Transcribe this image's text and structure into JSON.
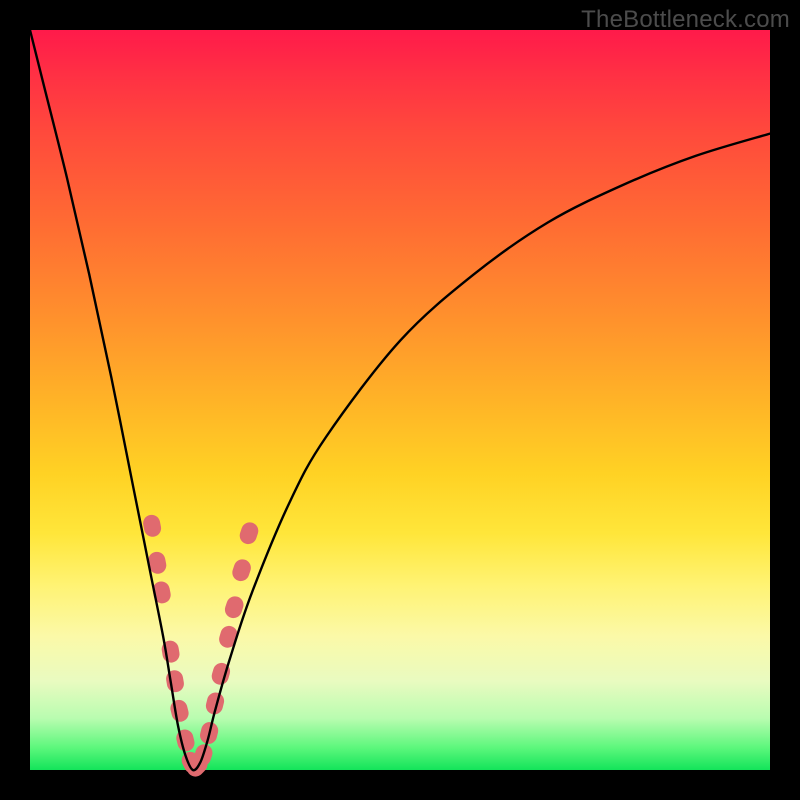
{
  "watermark": "TheBottleneck.com",
  "colors": {
    "frame": "#000000",
    "marker": "#e06a6f",
    "curve": "#000000"
  },
  "chart_data": {
    "type": "line",
    "title": "",
    "xlabel": "",
    "ylabel": "",
    "xlim": [
      0,
      100
    ],
    "ylim": [
      0,
      100
    ],
    "grid": false,
    "legend": false,
    "curve_description": "V-shaped bottleneck curve; minimum near x≈22 at y≈0, asymmetric — left arm is near-vertical, right arm rises gradually",
    "x": [
      0,
      2,
      5,
      8,
      11,
      14,
      16,
      18,
      19,
      20,
      21,
      22,
      23,
      24,
      25,
      27,
      30,
      35,
      40,
      50,
      60,
      70,
      80,
      90,
      100
    ],
    "y": [
      100,
      92,
      80,
      67,
      53,
      38,
      28,
      18,
      12,
      6,
      2,
      0,
      1,
      4,
      8,
      15,
      24,
      36,
      45,
      58,
      67,
      74,
      79,
      83,
      86
    ],
    "markers_description": "Salmon pill-shaped markers clustered along both arms near the trough (approx x 16–29, y 0–33)",
    "markers": [
      {
        "x": 16.5,
        "y": 33
      },
      {
        "x": 17.2,
        "y": 28
      },
      {
        "x": 17.8,
        "y": 24
      },
      {
        "x": 19.0,
        "y": 16
      },
      {
        "x": 19.6,
        "y": 12
      },
      {
        "x": 20.2,
        "y": 8
      },
      {
        "x": 21.0,
        "y": 4
      },
      {
        "x": 21.8,
        "y": 1
      },
      {
        "x": 22.6,
        "y": 0.5
      },
      {
        "x": 23.4,
        "y": 2
      },
      {
        "x": 24.2,
        "y": 5
      },
      {
        "x": 25.0,
        "y": 9
      },
      {
        "x": 25.8,
        "y": 13
      },
      {
        "x": 26.8,
        "y": 18
      },
      {
        "x": 27.6,
        "y": 22
      },
      {
        "x": 28.6,
        "y": 27
      },
      {
        "x": 29.6,
        "y": 32
      }
    ]
  }
}
